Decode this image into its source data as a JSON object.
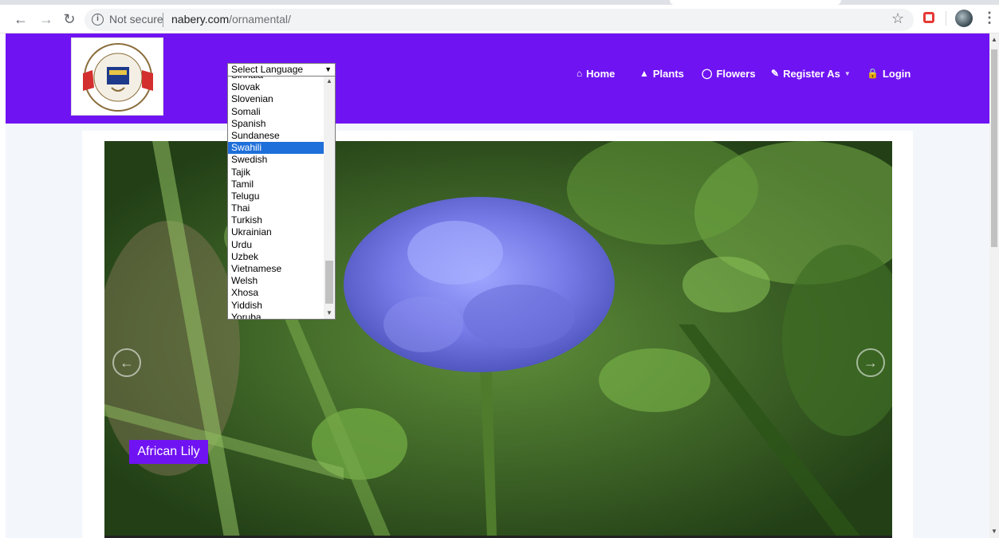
{
  "browser": {
    "back_icon": "arrow-left",
    "forward_icon": "arrow-right",
    "reload_icon": "reload",
    "security_label": "Not secure",
    "url_host": "nabery.com",
    "url_path": "/ornamental/"
  },
  "navbar": {
    "bg_color": "#7013f3",
    "items": [
      {
        "label": "Home",
        "icon": "home-icon"
      },
      {
        "label": "Plants",
        "icon": "tree-icon"
      },
      {
        "label": "Flowers",
        "icon": "leaf-icon"
      },
      {
        "label": "Register As",
        "icon": "pencil-icon"
      },
      {
        "label": "Login",
        "icon": "lock-icon"
      }
    ]
  },
  "language_select": {
    "selected": "Select Language",
    "options": [
      "Sinhala",
      "Slovak",
      "Slovenian",
      "Somali",
      "Spanish",
      "Sundanese",
      "Swahili",
      "Swedish",
      "Tajik",
      "Tamil",
      "Telugu",
      "Thai",
      "Turkish",
      "Ukrainian",
      "Urdu",
      "Uzbek",
      "Vietnamese",
      "Welsh",
      "Xhosa",
      "Yiddish",
      "Yoruba"
    ],
    "highlighted": "Swahili"
  },
  "carousel": {
    "caption": "African Lily",
    "prev_icon": "chevron-left-icon",
    "next_icon": "chevron-right-icon"
  }
}
